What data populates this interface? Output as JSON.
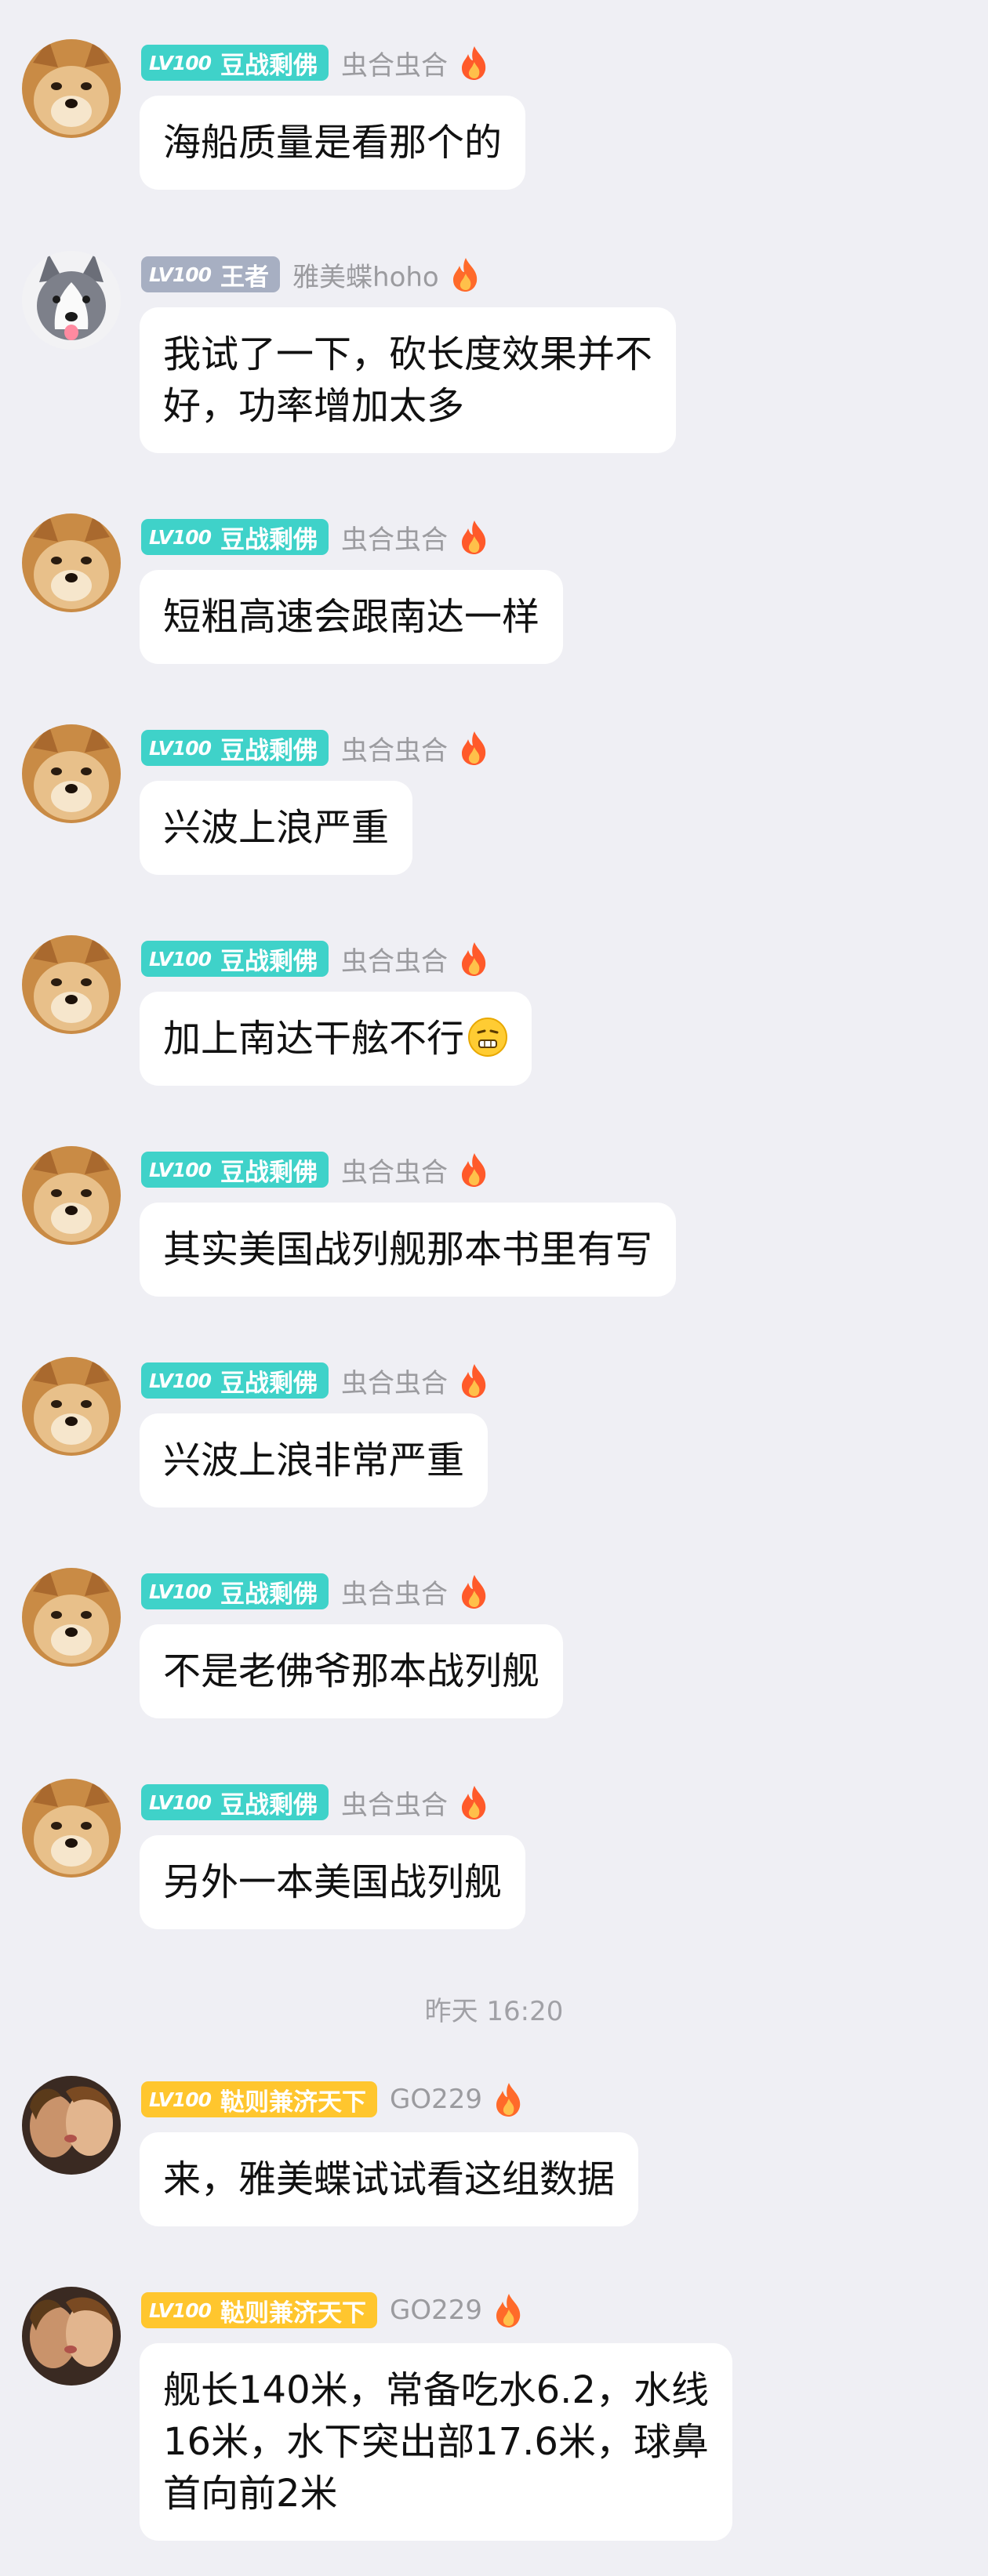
{
  "timestamp": "昨天 16:20",
  "messages": [
    {
      "badge_lv": "LV100",
      "badge_title": "豆战剩佛",
      "nick": "虫合虫合",
      "text": "海船质量是看那个的"
    },
    {
      "badge_lv": "LV100",
      "badge_title": "王者",
      "nick": "雅美蝶hoho",
      "text": "我试了一下，砍长度效果并不\n好，功率增加太多"
    },
    {
      "badge_lv": "LV100",
      "badge_title": "豆战剩佛",
      "nick": "虫合虫合",
      "text": "短粗高速会跟南达一样"
    },
    {
      "badge_lv": "LV100",
      "badge_title": "豆战剩佛",
      "nick": "虫合虫合",
      "text": "兴波上浪严重"
    },
    {
      "badge_lv": "LV100",
      "badge_title": "豆战剩佛",
      "nick": "虫合虫合",
      "text": "加上南达干舷不行"
    },
    {
      "badge_lv": "LV100",
      "badge_title": "豆战剩佛",
      "nick": "虫合虫合",
      "text": "其实美国战列舰那本书里有写"
    },
    {
      "badge_lv": "LV100",
      "badge_title": "豆战剩佛",
      "nick": "虫合虫合",
      "text": "兴波上浪非常严重"
    },
    {
      "badge_lv": "LV100",
      "badge_title": "豆战剩佛",
      "nick": "虫合虫合",
      "text": "不是老佛爷那本战列舰"
    },
    {
      "badge_lv": "LV100",
      "badge_title": "豆战剩佛",
      "nick": "虫合虫合",
      "text": "另外一本美国战列舰"
    },
    {
      "badge_lv": "LV100",
      "badge_title": "鞑则兼济天下",
      "nick": "GO229",
      "text": "来，雅美蝶试试看这组数据"
    },
    {
      "badge_lv": "LV100",
      "badge_title": "鞑则兼济天下",
      "nick": "GO229",
      "text": "舰长140米，常备吃水6.2，水线\n16米，水下突出部17.6米，球鼻\n首向前2米"
    }
  ],
  "colors": {
    "teal": "#3fd2c9",
    "gray": "#a7afc2",
    "yellow": "#ffc62e",
    "background": "#efeff4"
  }
}
